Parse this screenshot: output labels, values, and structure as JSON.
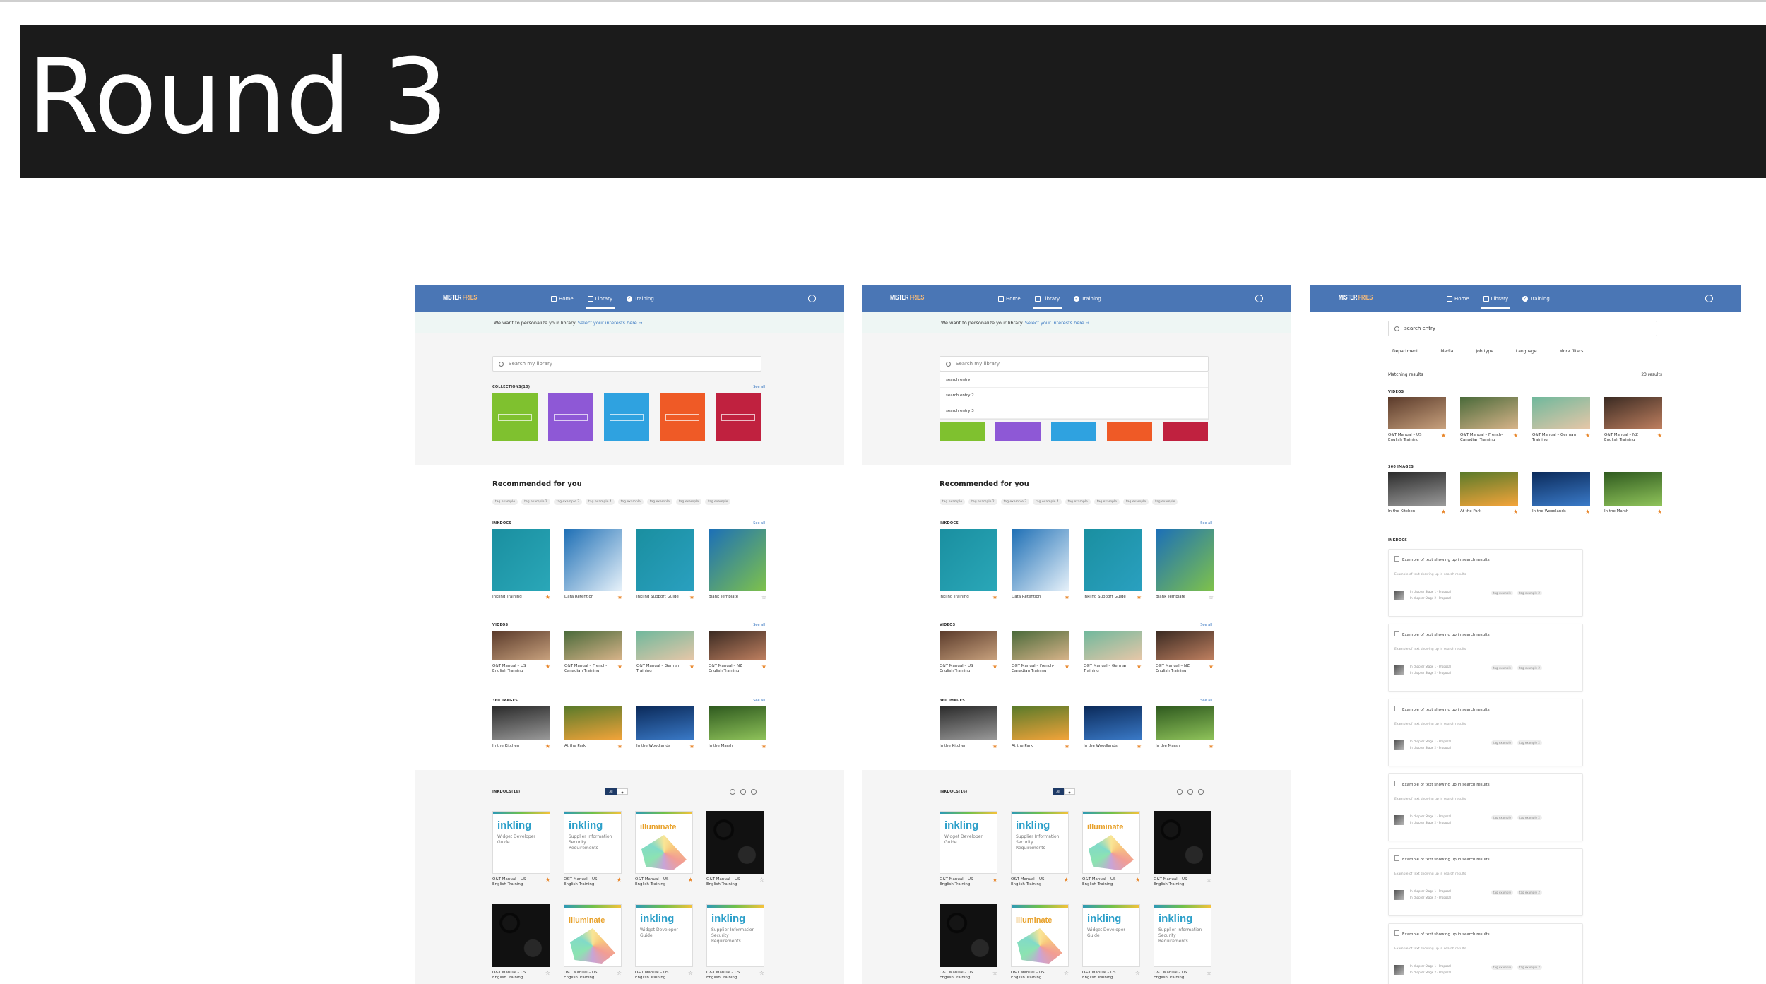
{
  "slide_title": "Round 3",
  "brand": {
    "part1": "MISTER",
    "part2": "FRIES"
  },
  "nav": {
    "home": "Home",
    "library": "Library",
    "training": "Training"
  },
  "personalize": {
    "text": "We want to personalize your library.",
    "link": "Select your interests here →"
  },
  "search_placeholder": "Search my library",
  "collections_label": "COLLECTIONS(10)",
  "see_all": "See all",
  "dropdown": [
    "search entry",
    "search entry 2",
    "search entry 3"
  ],
  "recommended": "Recommended for you",
  "tags": [
    "tag example",
    "tag example 2",
    "tag example 3",
    "tag example 4",
    "tag example",
    "tag example",
    "tag example",
    "tag example"
  ],
  "sections": {
    "inkdocs": "INKDOCS",
    "videos": "VIDEOS",
    "images360": "360 IMAGES",
    "inkdocs_count": "INKDOCS(16)"
  },
  "inkdocs": [
    "Inkling Training",
    "Data Retention",
    "Inkling Support Guide",
    "Blank Template"
  ],
  "videos": [
    "O&T Manual – US English Training",
    "O&T Manual – French-Canadian Training",
    "O&T Manual – German Training",
    "O&T Manual – NZ English Training"
  ],
  "images360": [
    "In the Kitchen",
    "At the Park",
    "In the Woodlands",
    "In the Marsh"
  ],
  "books": [
    {
      "kind": "inkling",
      "title": "inkling",
      "sub": "Widget Developer Guide",
      "cap": "O&T Manual – US English Training"
    },
    {
      "kind": "inkling",
      "title": "inkling",
      "sub": "Supplier Information Security Requirements",
      "cap": "O&T Manual – US English Training"
    },
    {
      "kind": "illum",
      "title": "illuminate",
      "sub": "",
      "cap": "O&T Manual – US English Training"
    },
    {
      "kind": "gears",
      "title": "",
      "sub": "",
      "cap": "O&T Manual – US English Training"
    },
    {
      "kind": "gears",
      "title": "",
      "sub": "",
      "cap": "O&T Manual – US English Training"
    },
    {
      "kind": "illum",
      "title": "illuminate",
      "sub": "",
      "cap": "O&T Manual – US English Training"
    },
    {
      "kind": "inkling",
      "title": "inkling",
      "sub": "Widget Developer Guide",
      "cap": "O&T Manual – US English Training"
    },
    {
      "kind": "inkling",
      "title": "inkling",
      "sub": "Supplier Information Security Requirements",
      "cap": "O&T Manual – US English Training"
    }
  ],
  "toggle": {
    "all": "All"
  },
  "results": {
    "query": "search entry",
    "filters": [
      "Department",
      "Media",
      "Job type",
      "Language",
      "More filters"
    ],
    "matching": "Matching results",
    "count": "23 results",
    "card_title": "Example of text showing up in search results",
    "card_sub": "Example of text showing up in search results",
    "line1": "In chapter Stage 1 - Proposal",
    "line2": "In chapter Stage 2 - Proposal",
    "tag1": "tag example",
    "tag2": "tag example 2"
  },
  "colors": {
    "nav": "#4a76b5",
    "title_bar": "#1b1b1b",
    "collections": [
      "#7fc12f",
      "#8e58d6",
      "#2fa2e0",
      "#ef5a26",
      "#c0213f"
    ]
  }
}
